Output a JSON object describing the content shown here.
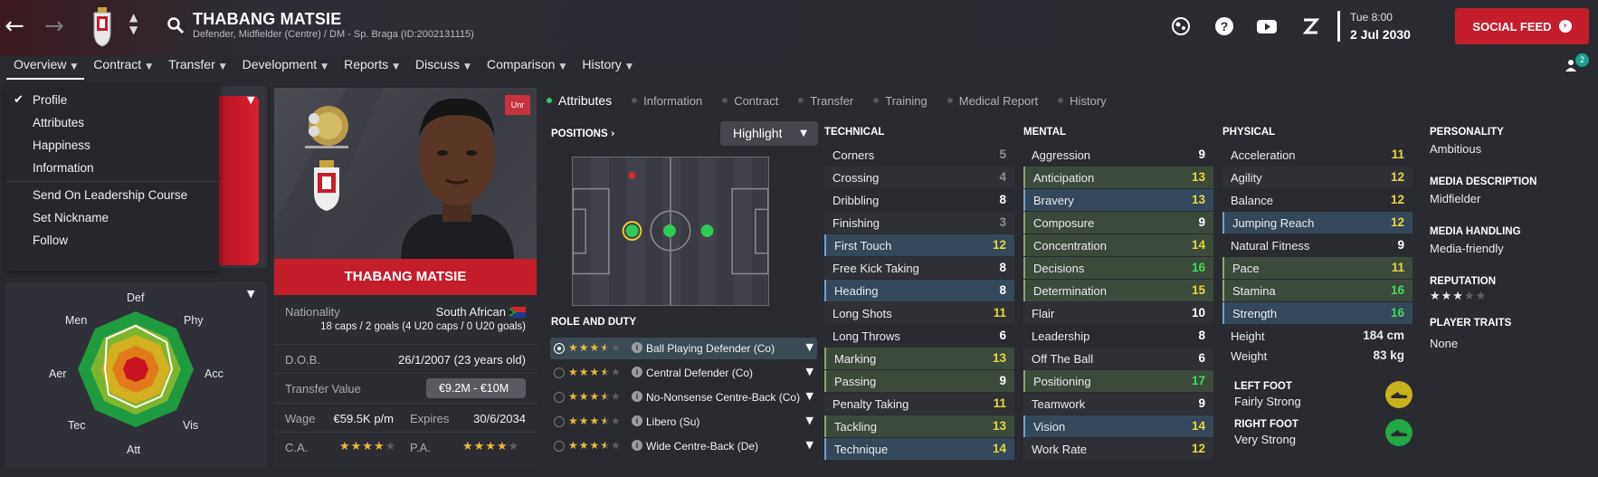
{
  "header": {
    "player_name": "THABANG MATSIE",
    "player_sub": "Defender, Midfielder (Centre) / DM - Sp. Braga (ID:2002131115)",
    "day_time": "Tue 8:00",
    "date": "2 Jul 2030",
    "social_feed": "SOCIAL FEED",
    "notification_count": "2"
  },
  "menu": [
    {
      "label": "Overview"
    },
    {
      "label": "Contract"
    },
    {
      "label": "Transfer"
    },
    {
      "label": "Development"
    },
    {
      "label": "Reports"
    },
    {
      "label": "Discuss"
    },
    {
      "label": "Comparison"
    },
    {
      "label": "History"
    }
  ],
  "dropdown": {
    "items": [
      "Profile",
      "Attributes",
      "Happiness",
      "Information"
    ],
    "actions": [
      "Send On Leadership Course",
      "Set Nickname",
      "Follow"
    ]
  },
  "radar": {
    "labels": {
      "def": "Def",
      "phy": "Phy",
      "acc": "Acc",
      "vis": "Vis",
      "att": "Att",
      "tec": "Tec",
      "aer": "Aer",
      "men": "Men"
    }
  },
  "card": {
    "unr": "Unr",
    "name": "THABANG MATSIE",
    "nationality_label": "Nationality",
    "nationality": "South African",
    "caps": "18 caps / 2 goals (4 U20 caps / 0 U20 goals)",
    "dob_label": "D.O.B.",
    "dob": "26/1/2007 (23 years old)",
    "tv_label": "Transfer Value",
    "tv": "€9.2M - €10M",
    "wage_label": "Wage",
    "wage": "€59.5K p/m",
    "expires_label": "Expires",
    "expires": "30/6/2034",
    "ca_label": "C.A.",
    "pa_label": "P.A."
  },
  "tabs": [
    "Attributes",
    "Information",
    "Contract",
    "Transfer",
    "Training",
    "Medical Report",
    "History"
  ],
  "positions": {
    "title": "POSITIONS",
    "highlight": "Highlight",
    "role_title": "ROLE AND DUTY",
    "roles": [
      {
        "name": "Ball Playing Defender (Co)",
        "stars": 3.5
      },
      {
        "name": "Central Defender (Co)",
        "stars": 3.5
      },
      {
        "name": "No-Nonsense Centre-Back (Co)",
        "stars": 3.5
      },
      {
        "name": "Libero (Su)",
        "stars": 3.5
      },
      {
        "name": "Wide Centre-Back (De)",
        "stars": 3.5
      }
    ]
  },
  "technical": {
    "title": "TECHNICAL",
    "attrs": [
      {
        "n": "Corners",
        "v": "5"
      },
      {
        "n": "Crossing",
        "v": "4"
      },
      {
        "n": "Dribbling",
        "v": "8"
      },
      {
        "n": "Finishing",
        "v": "3"
      },
      {
        "n": "First Touch",
        "v": "12"
      },
      {
        "n": "Free Kick Taking",
        "v": "8"
      },
      {
        "n": "Heading",
        "v": "8"
      },
      {
        "n": "Long Shots",
        "v": "11"
      },
      {
        "n": "Long Throws",
        "v": "6"
      },
      {
        "n": "Marking",
        "v": "13"
      },
      {
        "n": "Passing",
        "v": "9"
      },
      {
        "n": "Penalty Taking",
        "v": "11"
      },
      {
        "n": "Tackling",
        "v": "13"
      },
      {
        "n": "Technique",
        "v": "14"
      }
    ]
  },
  "mental": {
    "title": "MENTAL",
    "attrs": [
      {
        "n": "Aggression",
        "v": "9"
      },
      {
        "n": "Anticipation",
        "v": "13"
      },
      {
        "n": "Bravery",
        "v": "13"
      },
      {
        "n": "Composure",
        "v": "9"
      },
      {
        "n": "Concentration",
        "v": "14"
      },
      {
        "n": "Decisions",
        "v": "16"
      },
      {
        "n": "Determination",
        "v": "15"
      },
      {
        "n": "Flair",
        "v": "10"
      },
      {
        "n": "Leadership",
        "v": "8"
      },
      {
        "n": "Off The Ball",
        "v": "6"
      },
      {
        "n": "Positioning",
        "v": "17"
      },
      {
        "n": "Teamwork",
        "v": "9"
      },
      {
        "n": "Vision",
        "v": "14"
      },
      {
        "n": "Work Rate",
        "v": "12"
      }
    ]
  },
  "physical": {
    "title": "PHYSICAL",
    "attrs": [
      {
        "n": "Acceleration",
        "v": "11"
      },
      {
        "n": "Agility",
        "v": "12"
      },
      {
        "n": "Balance",
        "v": "12"
      },
      {
        "n": "Jumping Reach",
        "v": "12"
      },
      {
        "n": "Natural Fitness",
        "v": "9"
      },
      {
        "n": "Pace",
        "v": "11"
      },
      {
        "n": "Stamina",
        "v": "16"
      },
      {
        "n": "Strength",
        "v": "16"
      }
    ],
    "height_label": "Height",
    "height": "184 cm",
    "weight_label": "Weight",
    "weight": "83 kg",
    "left_foot_label": "LEFT FOOT",
    "left_foot": "Fairly Strong",
    "right_foot_label": "RIGHT FOOT",
    "right_foot": "Very Strong"
  },
  "side": {
    "personality_label": "PERSONALITY",
    "personality": "Ambitious",
    "media_desc_label": "MEDIA DESCRIPTION",
    "media_desc": "Midfielder",
    "media_handling_label": "MEDIA HANDLING",
    "media_handling": "Media-friendly",
    "reputation_label": "REPUTATION",
    "reputation_stars": 3,
    "traits_label": "PLAYER TRAITS",
    "traits": "None"
  },
  "colors": {
    "accent": "#c41e2a",
    "value_white": "#ffffff",
    "value_yellow": "#e8d53c",
    "value_green": "#3ddc5a",
    "value_grey": "#8e8e94"
  }
}
